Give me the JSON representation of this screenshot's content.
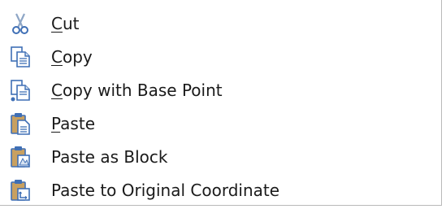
{
  "context_menu": {
    "items": [
      {
        "mnemonic": "C",
        "rest": "ut",
        "icon": "scissors-icon"
      },
      {
        "mnemonic": "C",
        "rest": "opy",
        "icon": "copy-icon"
      },
      {
        "mnemonic": "C",
        "rest": "opy with Base Point",
        "icon": "copy-with-base-point-icon"
      },
      {
        "mnemonic": "P",
        "rest": "aste",
        "icon": "paste-icon"
      },
      {
        "mnemonic": "",
        "rest": "Paste as Block",
        "icon": "paste-as-block-icon"
      },
      {
        "mnemonic": "",
        "rest": "Paste to Original Coordinate",
        "icon": "paste-to-original-coordinate-icon"
      }
    ]
  },
  "colors": {
    "icon_blue": "#3f6fb5",
    "icon_light": "#d7e3f2",
    "clipboard_board": "#c8a060",
    "scissors_blade": "#8ea6c6",
    "text": "#1a1a1a",
    "menu_border": "#b9b9b9"
  }
}
